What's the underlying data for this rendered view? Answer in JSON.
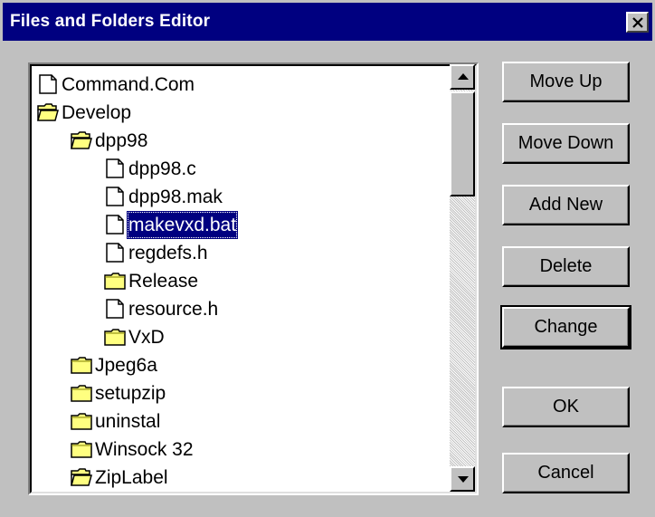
{
  "window": {
    "title": "Files and Folders Editor"
  },
  "tree": {
    "items": [
      {
        "label": "Command.Com",
        "icon": "file-icon",
        "level": 0
      },
      {
        "label": "Develop",
        "icon": "folder-open-icon",
        "level": 0
      },
      {
        "label": "dpp98",
        "icon": "folder-open-icon",
        "level": 1
      },
      {
        "label": "dpp98.c",
        "icon": "file-icon",
        "level": 2
      },
      {
        "label": "dpp98.mak",
        "icon": "file-icon",
        "level": 2
      },
      {
        "label": "makevxd.bat",
        "icon": "file-icon",
        "level": 2,
        "selected": true
      },
      {
        "label": "regdefs.h",
        "icon": "file-icon",
        "level": 2
      },
      {
        "label": "Release",
        "icon": "folder-icon",
        "level": 2
      },
      {
        "label": "resource.h",
        "icon": "file-icon",
        "level": 2
      },
      {
        "label": "VxD",
        "icon": "folder-icon",
        "level": 2
      },
      {
        "label": "Jpeg6a",
        "icon": "folder-icon",
        "level": 1
      },
      {
        "label": "setupzip",
        "icon": "folder-icon",
        "level": 1
      },
      {
        "label": "uninstal",
        "icon": "folder-icon",
        "level": 1
      },
      {
        "label": "Winsock 32",
        "icon": "folder-icon",
        "level": 1
      },
      {
        "label": "ZipLabel",
        "icon": "folder-open-icon",
        "level": 1
      }
    ]
  },
  "buttons": {
    "move_up": "Move Up",
    "move_down": "Move Down",
    "add_new": "Add New",
    "delete": "Delete",
    "change": "Change",
    "ok": "OK",
    "cancel": "Cancel"
  },
  "colors": {
    "titlebar": "#000080",
    "face": "#c0c0c0",
    "selection": "#000080",
    "folder": "#ffff80"
  }
}
